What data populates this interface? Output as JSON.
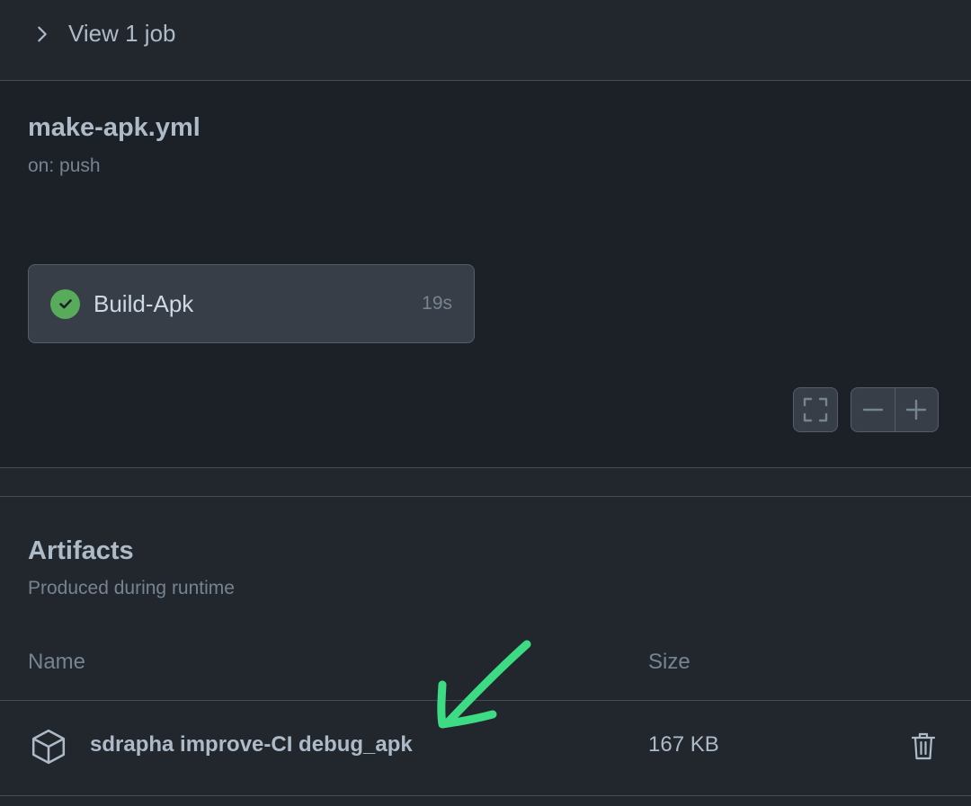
{
  "jobs_toggle": {
    "label": "View 1 job",
    "icon": "chevron-right-icon"
  },
  "workflow": {
    "file": "make-apk.yml",
    "trigger": "on: push",
    "job": {
      "name": "Build-Apk",
      "duration": "19s",
      "status": "success",
      "status_color": "#57ab5a"
    },
    "controls": {
      "fit_icon": "fullscreen-icon",
      "zoom_out_icon": "minus-icon",
      "zoom_in_icon": "plus-icon"
    }
  },
  "artifacts": {
    "title": "Artifacts",
    "subtitle": "Produced during runtime",
    "columns": {
      "name": "Name",
      "size": "Size"
    },
    "rows": [
      {
        "name": "sdrapha improve-CI debug_apk",
        "size": "167 KB",
        "icon": "package-icon",
        "action_icon": "trash-icon"
      }
    ]
  },
  "annotation": {
    "color": "#3ddc84",
    "icon": "hand-drawn-arrow"
  }
}
